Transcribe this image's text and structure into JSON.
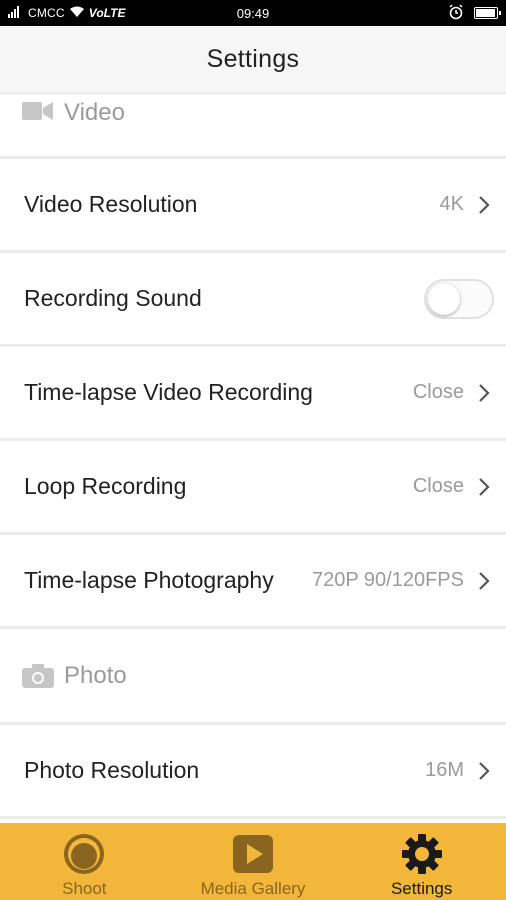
{
  "status_bar": {
    "carrier": "CMCC",
    "network": "VoLTE",
    "time": "09:49"
  },
  "header": {
    "title": "Settings"
  },
  "sections": {
    "video": {
      "title": "Video",
      "icon": "video-camera-icon",
      "rows": [
        {
          "label": "Video Resolution",
          "value": "4K"
        },
        {
          "label": "Recording Sound",
          "toggle_on": false
        },
        {
          "label": "Time-lapse Video Recording",
          "value": "Close"
        },
        {
          "label": "Loop Recording",
          "value": "Close"
        },
        {
          "label": "Time-lapse Photography",
          "value": "720P 90/120FPS"
        }
      ]
    },
    "photo": {
      "title": "Photo",
      "icon": "camera-icon",
      "rows": [
        {
          "label": "Photo Resolution",
          "value": "16M"
        }
      ]
    }
  },
  "tab_bar": {
    "tabs": [
      {
        "label": "Shoot",
        "icon": "shoot-icon",
        "active": false
      },
      {
        "label": "Media Gallery",
        "icon": "play-icon",
        "active": false
      },
      {
        "label": "Settings",
        "icon": "gear-icon",
        "active": true
      }
    ]
  },
  "colors": {
    "tab_bar_bg": "#f2b73a",
    "inactive_tab": "#8a6520",
    "active_tab": "#1a1a1a",
    "secondary_text": "#9a9a9a"
  }
}
